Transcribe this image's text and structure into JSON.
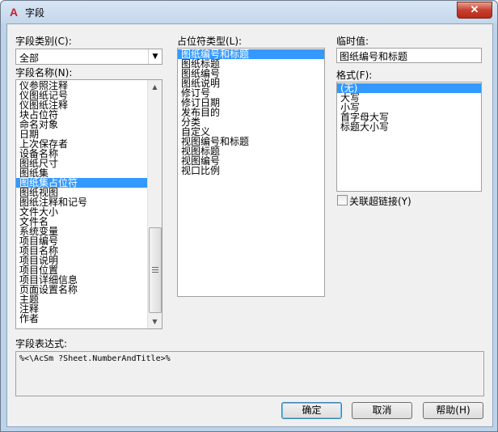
{
  "window": {
    "title": "字段",
    "app_icon": "A",
    "close_glyph": "✕"
  },
  "field_category": {
    "label": "字段类别(C):",
    "value": "全部"
  },
  "field_names": {
    "label": "字段名称(N):",
    "items": [
      "仪参照注释",
      "仪图纸记号",
      "仪图纸注释",
      "块占位符",
      "命名对象",
      "日期",
      "上次保存者",
      "设备名称",
      "图纸尺寸",
      "图纸集",
      "图纸集占位符",
      "图纸视图",
      "图纸注释和记号",
      "文件大小",
      "文件名",
      "系统变量",
      "项目编号",
      "项目名称",
      "项目说明",
      "项目位置",
      "项目详细信息",
      "页面设置名称",
      "主题",
      "注释",
      "作者"
    ],
    "selected_index": 10
  },
  "placeholder_type": {
    "label": "占位符类型(L):",
    "items": [
      "图纸编号和标题",
      "图纸标题",
      "图纸编号",
      "图纸说明",
      "修订号",
      "修订日期",
      "发布目的",
      "分类",
      "自定义",
      "视图编号和标题",
      "视图标题",
      "视图编号",
      "视口比例"
    ],
    "selected_index": 0
  },
  "temp_value": {
    "label": "临时值:",
    "value": "图纸编号和标题"
  },
  "format": {
    "label": "格式(F):",
    "items": [
      "(无)",
      "大写",
      "小写",
      "首字母大写",
      "标题大小写"
    ],
    "selected_index": 0
  },
  "hyperlink": {
    "label": "关联超链接(Y)",
    "checked": false
  },
  "field_expression": {
    "label": "字段表达式:",
    "value": "%<\\AcSm ?Sheet.NumberAndTitle>%"
  },
  "buttons": {
    "ok": "确定",
    "cancel": "取消",
    "help": "帮助(H)"
  },
  "icons": {
    "scroll_up": "▲",
    "scroll_down": "▼",
    "combo_arrow": "▼"
  }
}
